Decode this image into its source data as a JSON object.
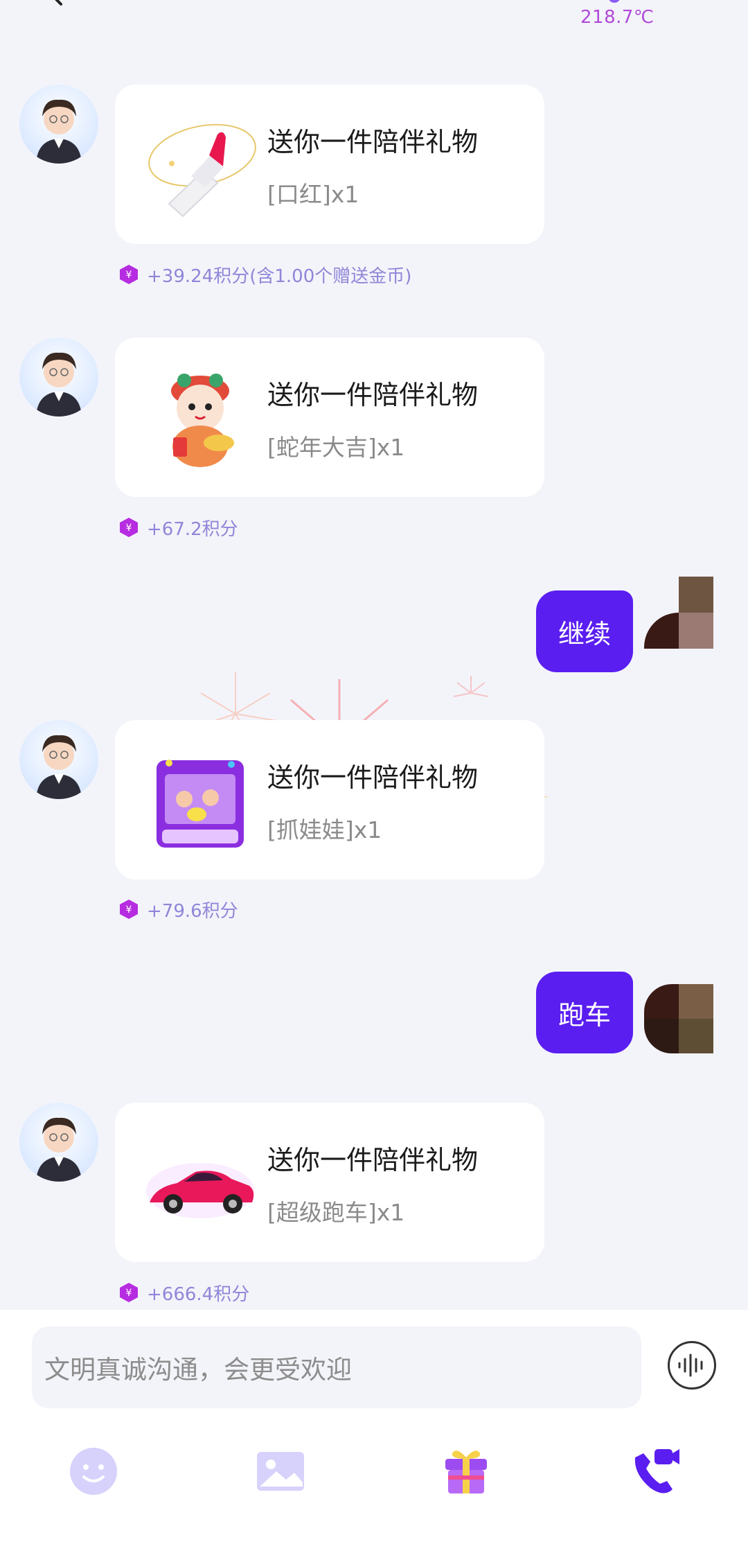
{
  "header": {
    "temperature": "218.7℃"
  },
  "messages": [
    {
      "type": "gift",
      "title": "送你一件陪伴礼物",
      "gift_text": "[口红]x1",
      "gift_icon": "lipstick",
      "points": "+39.24积分(含1.00个赠送金币)"
    },
    {
      "type": "gift",
      "title": "送你一件陪伴礼物",
      "gift_text": "[蛇年大吉]x1",
      "gift_icon": "snake-year-mascot",
      "points": "+67.2积分"
    },
    {
      "type": "text",
      "text": "继续"
    },
    {
      "type": "gift",
      "title": "送你一件陪伴礼物",
      "gift_text": "[抓娃娃]x1",
      "gift_icon": "claw-machine",
      "points": "+79.6积分"
    },
    {
      "type": "text",
      "text": "跑车"
    },
    {
      "type": "gift",
      "title": "送你一件陪伴礼物",
      "gift_text": "[超级跑车]x1",
      "gift_icon": "sports-car",
      "points": "+666.4积分"
    }
  ],
  "input": {
    "placeholder": "文明真诚沟通，会更受欢迎"
  },
  "toolbar": {
    "icons": [
      "emoji-icon",
      "image-icon",
      "gift-icon",
      "video-call-icon"
    ]
  },
  "colors": {
    "accent": "#5a1ef0",
    "points_text": "#8f86d8",
    "temperature": "#b14ad9",
    "background": "#f3f4fa"
  }
}
